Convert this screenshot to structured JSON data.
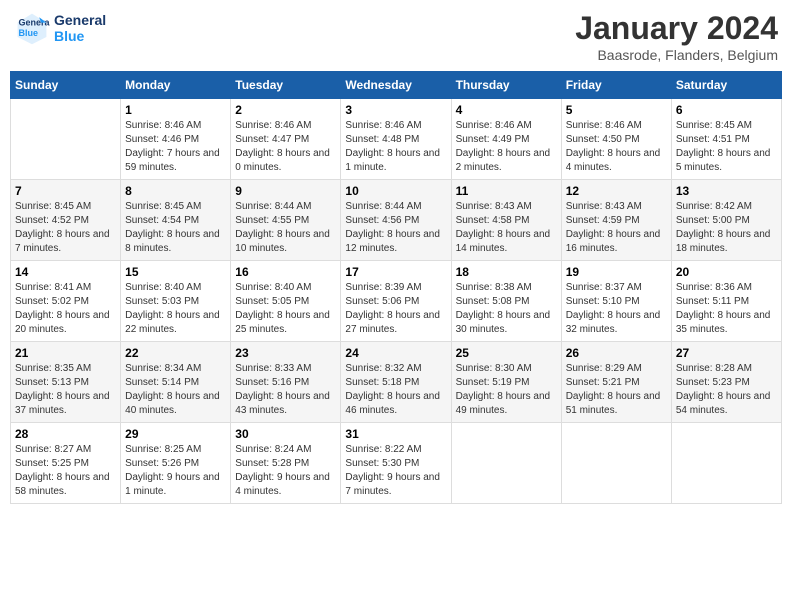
{
  "header": {
    "logo_line1": "General",
    "logo_line2": "Blue",
    "title": "January 2024",
    "subtitle": "Baasrode, Flanders, Belgium"
  },
  "weekdays": [
    "Sunday",
    "Monday",
    "Tuesday",
    "Wednesday",
    "Thursday",
    "Friday",
    "Saturday"
  ],
  "weeks": [
    [
      {
        "day": "",
        "sunrise": "",
        "sunset": "",
        "daylight": ""
      },
      {
        "day": "1",
        "sunrise": "Sunrise: 8:46 AM",
        "sunset": "Sunset: 4:46 PM",
        "daylight": "Daylight: 7 hours and 59 minutes."
      },
      {
        "day": "2",
        "sunrise": "Sunrise: 8:46 AM",
        "sunset": "Sunset: 4:47 PM",
        "daylight": "Daylight: 8 hours and 0 minutes."
      },
      {
        "day": "3",
        "sunrise": "Sunrise: 8:46 AM",
        "sunset": "Sunset: 4:48 PM",
        "daylight": "Daylight: 8 hours and 1 minute."
      },
      {
        "day": "4",
        "sunrise": "Sunrise: 8:46 AM",
        "sunset": "Sunset: 4:49 PM",
        "daylight": "Daylight: 8 hours and 2 minutes."
      },
      {
        "day": "5",
        "sunrise": "Sunrise: 8:46 AM",
        "sunset": "Sunset: 4:50 PM",
        "daylight": "Daylight: 8 hours and 4 minutes."
      },
      {
        "day": "6",
        "sunrise": "Sunrise: 8:45 AM",
        "sunset": "Sunset: 4:51 PM",
        "daylight": "Daylight: 8 hours and 5 minutes."
      }
    ],
    [
      {
        "day": "7",
        "sunrise": "Sunrise: 8:45 AM",
        "sunset": "Sunset: 4:52 PM",
        "daylight": "Daylight: 8 hours and 7 minutes."
      },
      {
        "day": "8",
        "sunrise": "Sunrise: 8:45 AM",
        "sunset": "Sunset: 4:54 PM",
        "daylight": "Daylight: 8 hours and 8 minutes."
      },
      {
        "day": "9",
        "sunrise": "Sunrise: 8:44 AM",
        "sunset": "Sunset: 4:55 PM",
        "daylight": "Daylight: 8 hours and 10 minutes."
      },
      {
        "day": "10",
        "sunrise": "Sunrise: 8:44 AM",
        "sunset": "Sunset: 4:56 PM",
        "daylight": "Daylight: 8 hours and 12 minutes."
      },
      {
        "day": "11",
        "sunrise": "Sunrise: 8:43 AM",
        "sunset": "Sunset: 4:58 PM",
        "daylight": "Daylight: 8 hours and 14 minutes."
      },
      {
        "day": "12",
        "sunrise": "Sunrise: 8:43 AM",
        "sunset": "Sunset: 4:59 PM",
        "daylight": "Daylight: 8 hours and 16 minutes."
      },
      {
        "day": "13",
        "sunrise": "Sunrise: 8:42 AM",
        "sunset": "Sunset: 5:00 PM",
        "daylight": "Daylight: 8 hours and 18 minutes."
      }
    ],
    [
      {
        "day": "14",
        "sunrise": "Sunrise: 8:41 AM",
        "sunset": "Sunset: 5:02 PM",
        "daylight": "Daylight: 8 hours and 20 minutes."
      },
      {
        "day": "15",
        "sunrise": "Sunrise: 8:40 AM",
        "sunset": "Sunset: 5:03 PM",
        "daylight": "Daylight: 8 hours and 22 minutes."
      },
      {
        "day": "16",
        "sunrise": "Sunrise: 8:40 AM",
        "sunset": "Sunset: 5:05 PM",
        "daylight": "Daylight: 8 hours and 25 minutes."
      },
      {
        "day": "17",
        "sunrise": "Sunrise: 8:39 AM",
        "sunset": "Sunset: 5:06 PM",
        "daylight": "Daylight: 8 hours and 27 minutes."
      },
      {
        "day": "18",
        "sunrise": "Sunrise: 8:38 AM",
        "sunset": "Sunset: 5:08 PM",
        "daylight": "Daylight: 8 hours and 30 minutes."
      },
      {
        "day": "19",
        "sunrise": "Sunrise: 8:37 AM",
        "sunset": "Sunset: 5:10 PM",
        "daylight": "Daylight: 8 hours and 32 minutes."
      },
      {
        "day": "20",
        "sunrise": "Sunrise: 8:36 AM",
        "sunset": "Sunset: 5:11 PM",
        "daylight": "Daylight: 8 hours and 35 minutes."
      }
    ],
    [
      {
        "day": "21",
        "sunrise": "Sunrise: 8:35 AM",
        "sunset": "Sunset: 5:13 PM",
        "daylight": "Daylight: 8 hours and 37 minutes."
      },
      {
        "day": "22",
        "sunrise": "Sunrise: 8:34 AM",
        "sunset": "Sunset: 5:14 PM",
        "daylight": "Daylight: 8 hours and 40 minutes."
      },
      {
        "day": "23",
        "sunrise": "Sunrise: 8:33 AM",
        "sunset": "Sunset: 5:16 PM",
        "daylight": "Daylight: 8 hours and 43 minutes."
      },
      {
        "day": "24",
        "sunrise": "Sunrise: 8:32 AM",
        "sunset": "Sunset: 5:18 PM",
        "daylight": "Daylight: 8 hours and 46 minutes."
      },
      {
        "day": "25",
        "sunrise": "Sunrise: 8:30 AM",
        "sunset": "Sunset: 5:19 PM",
        "daylight": "Daylight: 8 hours and 49 minutes."
      },
      {
        "day": "26",
        "sunrise": "Sunrise: 8:29 AM",
        "sunset": "Sunset: 5:21 PM",
        "daylight": "Daylight: 8 hours and 51 minutes."
      },
      {
        "day": "27",
        "sunrise": "Sunrise: 8:28 AM",
        "sunset": "Sunset: 5:23 PM",
        "daylight": "Daylight: 8 hours and 54 minutes."
      }
    ],
    [
      {
        "day": "28",
        "sunrise": "Sunrise: 8:27 AM",
        "sunset": "Sunset: 5:25 PM",
        "daylight": "Daylight: 8 hours and 58 minutes."
      },
      {
        "day": "29",
        "sunrise": "Sunrise: 8:25 AM",
        "sunset": "Sunset: 5:26 PM",
        "daylight": "Daylight: 9 hours and 1 minute."
      },
      {
        "day": "30",
        "sunrise": "Sunrise: 8:24 AM",
        "sunset": "Sunset: 5:28 PM",
        "daylight": "Daylight: 9 hours and 4 minutes."
      },
      {
        "day": "31",
        "sunrise": "Sunrise: 8:22 AM",
        "sunset": "Sunset: 5:30 PM",
        "daylight": "Daylight: 9 hours and 7 minutes."
      },
      {
        "day": "",
        "sunrise": "",
        "sunset": "",
        "daylight": ""
      },
      {
        "day": "",
        "sunrise": "",
        "sunset": "",
        "daylight": ""
      },
      {
        "day": "",
        "sunrise": "",
        "sunset": "",
        "daylight": ""
      }
    ]
  ]
}
